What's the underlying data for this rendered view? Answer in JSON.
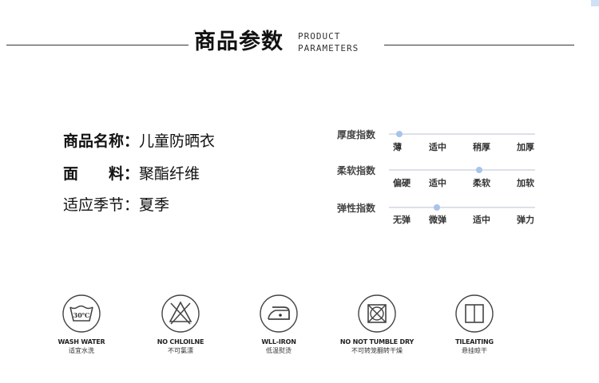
{
  "header": {
    "title": "商品参数",
    "subtitle_line1": "PRODUCT",
    "subtitle_line2": "PARAMETERS"
  },
  "info": [
    {
      "label": "商品名称：",
      "value": "儿童防晒衣"
    },
    {
      "label": "面　　料：",
      "value": "聚酯纤维"
    },
    {
      "label": "适应季节：",
      "value": "夏季"
    }
  ],
  "scales": [
    {
      "label": "厚度指数",
      "options": [
        "薄",
        "适中",
        "稍厚",
        "加厚"
      ],
      "selected_fraction": 0.05
    },
    {
      "label": "柔软指数",
      "options": [
        "偏硬",
        "适中",
        "柔软",
        "加软"
      ],
      "selected_fraction": 0.62
    },
    {
      "label": "弹性指数",
      "options": [
        "无弹",
        "微弹",
        "适中",
        "弹力"
      ],
      "selected_fraction": 0.32
    }
  ],
  "care": [
    {
      "icon": "wash-30-icon",
      "en": "WASH WATER",
      "cn": "适宜水洗",
      "temp": "30℃"
    },
    {
      "icon": "no-bleach-icon",
      "en": "NO CHLOILNE",
      "cn": "不可氯漂"
    },
    {
      "icon": "low-iron-icon",
      "en": "WLL-IRON",
      "cn": "低温熨烫"
    },
    {
      "icon": "no-tumble-dry-icon",
      "en": "NO NOT TUMBLE DRY",
      "cn": "不可转笼翻转干燥"
    },
    {
      "icon": "hang-dry-icon",
      "en": "TILEAITING",
      "cn": "悬挂晾干"
    }
  ],
  "colors": {
    "accent": "#a9c3ea",
    "track": "#dde0ea",
    "text": "#222222"
  }
}
